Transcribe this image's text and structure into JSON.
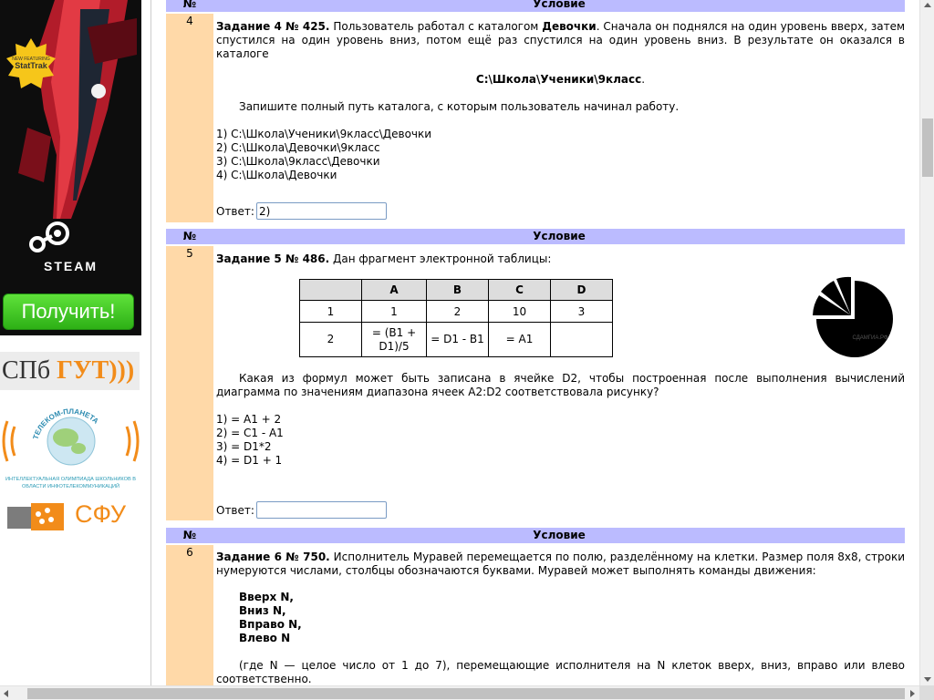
{
  "ads": {
    "stattrak_badge": "NEW FEATURING StatTrak",
    "steam_label": "STEAM",
    "get_button": "Получить!",
    "spbgut_a": "СПб",
    "spbgut_b": "ГУТ",
    "telecom_arc": "ТЕЛЕКОМ-ПЛАНЕТА",
    "telecom_caption": "Интеллектуальная олимпиада школьников в области инфотелекоммуникаций",
    "sfu": "СФУ"
  },
  "table_header": {
    "num": "№",
    "condition": "Условие"
  },
  "tasks": [
    {
      "number": "4",
      "title": "Задание 4 № 425.",
      "intro_a": " Пользователь работал с каталогом ",
      "intro_bold": "Девочки",
      "intro_b": ". Сначала он поднялся на один уровень вверх, затем спустился на один уровень вниз, потом ещё раз спустился на один уровень вниз. В результате он оказался в каталоге",
      "path": "С:\\Школа\\Ученики\\9класс",
      "path_dot": ".",
      "question": "Запишите полный путь каталога, с которым пользователь начинал работу.",
      "options": [
        "1) С:\\Школа\\Ученики\\9класс\\Девочки",
        "2) С:\\Школа\\Девочки\\9класс",
        "3) С:\\Школа\\9класс\\Девочки",
        "4) С:\\Школа\\Девочки"
      ],
      "answer_label": "Ответ:",
      "answer_value": "2)"
    },
    {
      "number": "5",
      "title": "Задание 5 № 486.",
      "intro": " Дан фрагмент электронной таблицы:",
      "sheet": {
        "header": [
          "",
          "A",
          "B",
          "C",
          "D"
        ],
        "row1": [
          "1",
          "1",
          "2",
          "10",
          "3"
        ],
        "row2": [
          "2",
          "= (B1 + D1)/5",
          "= D1 - B1",
          "= A1",
          ""
        ]
      },
      "pie_watermark": "СДАМГИА.РФ",
      "question": "Какая из формул может быть записана в ячейке D2, чтобы построенная после выполнения вычислений диаграмма по значениям диапазона ячеек A2:D2 соответствовала рисунку?",
      "options": [
        "1) = A1 + 2",
        "2) = C1 - A1",
        "3) = D1*2",
        "4) = D1 + 1"
      ],
      "answer_label": "Ответ:",
      "answer_value": ""
    },
    {
      "number": "6",
      "title": "Задание 6 № 750.",
      "intro": " Исполнитель Муравей перемещается по полю, разделённому на клетки. Размер поля 8x8, строки нумеруются числами, столбцы обозначаются буквами. Муравей может выполнять команды движения:",
      "commands": [
        "Вверх N,",
        "Вниз N,",
        "Вправо N,",
        "Влево N"
      ],
      "note": "(где N — целое число от 1 до 7), перемещающие исполнителя на N клеток вверх, вниз, вправо или влево соответ­ственно."
    }
  ]
}
